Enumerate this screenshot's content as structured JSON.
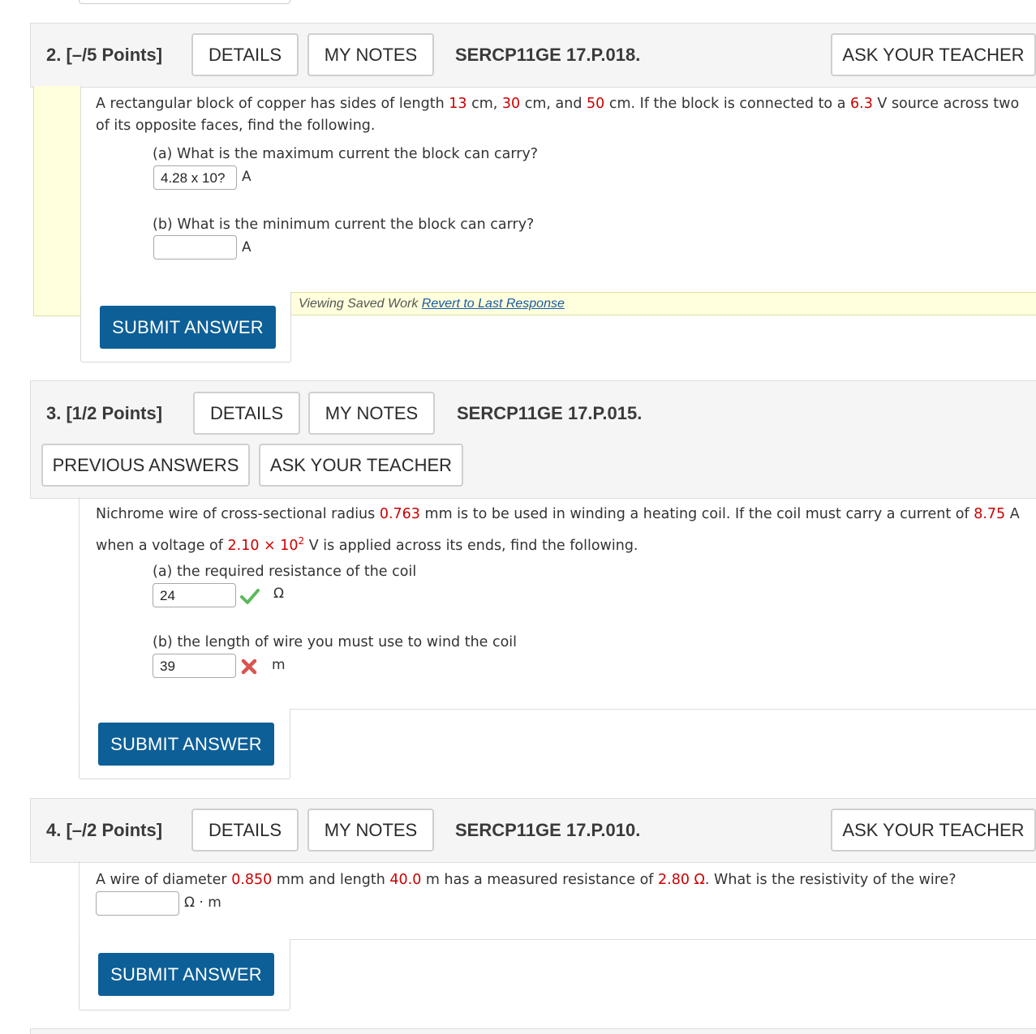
{
  "q2": {
    "number": "2.",
    "points": "[–/5 Points]",
    "details_label": "DETAILS",
    "notes_label": "MY NOTES",
    "code": "SERCP11GE 17.P.018.",
    "ask_label": "ASK YOUR TEACHER",
    "intro": {
      "p1": "A rectangular block of copper has sides of length ",
      "v1": "13",
      "p2": " cm, ",
      "v2": "30",
      "p3": " cm, and ",
      "v3": "50",
      "p4": " cm. If the block is connected to a ",
      "v4": "6.3",
      "p5": " V source across two",
      "line2": "of its opposite faces, find the following."
    },
    "part_a": {
      "prompt": "(a) What is the maximum current the block can carry?",
      "value": "4.28 x 10?",
      "unit": "A"
    },
    "part_b": {
      "prompt": "(b) What is the minimum current the block can carry?",
      "value": "",
      "unit": "A"
    },
    "saved_text": "Viewing Saved Work ",
    "revert_link": "Revert to Last Response",
    "submit_label": "SUBMIT ANSWER"
  },
  "q3": {
    "number": "3.",
    "points": "[1/2 Points]",
    "details_label": "DETAILS",
    "notes_label": "MY NOTES",
    "code": "SERCP11GE 17.P.015.",
    "prev_label": "PREVIOUS ANSWERS",
    "ask_label": "ASK YOUR TEACHER",
    "intro": {
      "p1": "Nichrome wire of cross-sectional radius ",
      "v1": "0.763",
      "p2": " mm is to be used in winding a heating coil. If the coil must carry a current of ",
      "v2": "8.75",
      "p3": " A",
      "l2p1": "when a voltage of ",
      "v3": "2.10 × 10",
      "v3exp": "2",
      "l2p2": " V is applied across its ends, find the following."
    },
    "part_a": {
      "prompt": "(a) the required resistance of the coil",
      "value": "24",
      "unit": "Ω",
      "status": "correct"
    },
    "part_b": {
      "prompt": "(b) the length of wire you must use to wind the coil",
      "value": "39",
      "unit": "m",
      "status": "incorrect"
    },
    "submit_label": "SUBMIT ANSWER"
  },
  "q4": {
    "number": "4.",
    "points": "[–/2 Points]",
    "details_label": "DETAILS",
    "notes_label": "MY NOTES",
    "code": "SERCP11GE 17.P.010.",
    "ask_label": "ASK YOUR TEACHER",
    "intro": {
      "p1": "A wire of diameter ",
      "v1": "0.850",
      "p2": " mm and length ",
      "v2": "40.0",
      "p3": " m has a measured resistance of ",
      "v3": "2.80",
      "p4": " Ω",
      "p5": ". What is the resistivity of the wire?"
    },
    "answer": {
      "value": "",
      "unit": "Ω · m"
    },
    "submit_label": "SUBMIT ANSWER"
  },
  "colors": {
    "value_red": "#cc0000",
    "submit_blue": "#0d5f97",
    "check_green": "#5cb85c",
    "cross_red": "#d9534f",
    "saved_yellow": "#ffffdd"
  }
}
